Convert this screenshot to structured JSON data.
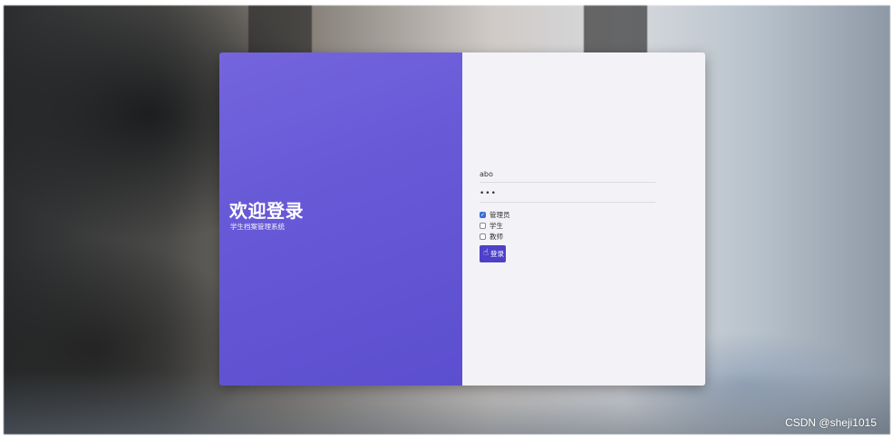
{
  "welcome": {
    "title": "欢迎登录",
    "subtitle": "学生档案管理系统"
  },
  "form": {
    "username_value": "abo",
    "password_value": "•••",
    "roles": [
      {
        "label": "管理员",
        "checked": true
      },
      {
        "label": "学生",
        "checked": false
      },
      {
        "label": "教师",
        "checked": false
      }
    ],
    "login_label": "登录"
  },
  "watermark": "CSDN @sheji1015",
  "colors": {
    "accent": "#5c4fcf",
    "button": "#4e40c9",
    "panel": "#f3f2f6"
  }
}
